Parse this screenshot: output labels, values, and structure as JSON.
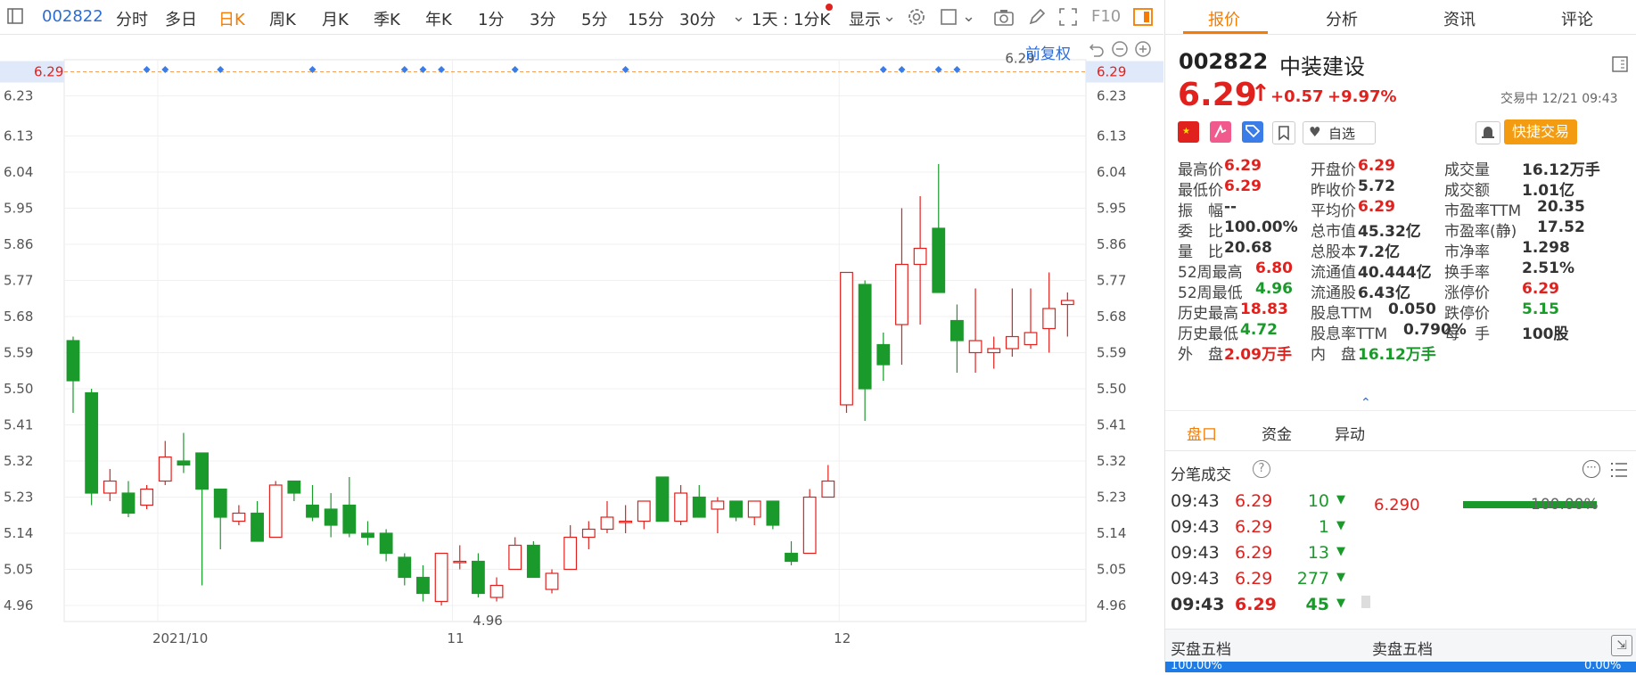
{
  "toolbar": {
    "code": "002822",
    "items": [
      "分时",
      "多日",
      "日K",
      "周K",
      "月K",
      "季K",
      "年K",
      "1分",
      "3分",
      "5分",
      "15分",
      "30分"
    ],
    "active": "日K",
    "range": "1天 : 1分K",
    "display": "显示",
    "f10": "F10"
  },
  "chart": {
    "fq_label": "前复权",
    "current_price": "6.29",
    "current_price_tag": "6.29",
    "high_label": "6.29",
    "low_label": "4.96",
    "x_labels": [
      "2021/10",
      "11",
      "12"
    ],
    "y_ticks": [
      "6.23",
      "6.13",
      "6.04",
      "5.95",
      "5.86",
      "5.77",
      "5.68",
      "5.59",
      "5.50",
      "5.41",
      "5.32",
      "5.23",
      "5.14",
      "5.05",
      "4.96"
    ]
  },
  "chart_data": {
    "type": "candlestick",
    "ylim": [
      4.92,
      6.32
    ],
    "y_ticks": [
      6.23,
      6.13,
      6.04,
      5.95,
      5.86,
      5.77,
      5.68,
      5.59,
      5.5,
      5.41,
      5.32,
      5.23,
      5.14,
      5.05,
      4.96
    ],
    "x_labels": [
      "2021/10",
      "11",
      "12"
    ],
    "current_price": 6.29,
    "max_label": 6.29,
    "min_label": 4.96,
    "candles": [
      {
        "o": 5.62,
        "c": 5.52,
        "h": 5.63,
        "l": 5.44
      },
      {
        "o": 5.49,
        "c": 5.24,
        "h": 5.5,
        "l": 5.21
      },
      {
        "o": 5.24,
        "c": 5.27,
        "h": 5.3,
        "l": 5.22
      },
      {
        "o": 5.24,
        "c": 5.19,
        "h": 5.27,
        "l": 5.18
      },
      {
        "o": 5.21,
        "c": 5.25,
        "h": 5.26,
        "l": 5.2
      },
      {
        "o": 5.27,
        "c": 5.33,
        "h": 5.37,
        "l": 5.26
      },
      {
        "o": 5.32,
        "c": 5.31,
        "h": 5.39,
        "l": 5.29
      },
      {
        "o": 5.34,
        "c": 5.25,
        "h": 5.34,
        "l": 5.01
      },
      {
        "o": 5.25,
        "c": 5.18,
        "h": 5.25,
        "l": 5.1
      },
      {
        "o": 5.17,
        "c": 5.19,
        "h": 5.21,
        "l": 5.16
      },
      {
        "o": 5.19,
        "c": 5.12,
        "h": 5.22,
        "l": 5.12
      },
      {
        "o": 5.13,
        "c": 5.26,
        "h": 5.27,
        "l": 5.13
      },
      {
        "o": 5.27,
        "c": 5.24,
        "h": 5.27,
        "l": 5.22
      },
      {
        "o": 5.21,
        "c": 5.18,
        "h": 5.26,
        "l": 5.17
      },
      {
        "o": 5.2,
        "c": 5.16,
        "h": 5.24,
        "l": 5.13
      },
      {
        "o": 5.21,
        "c": 5.14,
        "h": 5.28,
        "l": 5.13
      },
      {
        "o": 5.14,
        "c": 5.13,
        "h": 5.17,
        "l": 5.11
      },
      {
        "o": 5.14,
        "c": 5.09,
        "h": 5.15,
        "l": 5.07
      },
      {
        "o": 5.08,
        "c": 5.03,
        "h": 5.09,
        "l": 5.01
      },
      {
        "o": 5.03,
        "c": 4.99,
        "h": 5.06,
        "l": 4.97
      },
      {
        "o": 4.97,
        "c": 5.09,
        "h": 5.09,
        "l": 4.96
      },
      {
        "o": 5.07,
        "c": 5.07,
        "h": 5.11,
        "l": 5.05
      },
      {
        "o": 5.07,
        "c": 4.99,
        "h": 5.09,
        "l": 4.98
      },
      {
        "o": 4.98,
        "c": 5.01,
        "h": 5.03,
        "l": 4.97
      },
      {
        "o": 5.05,
        "c": 5.11,
        "h": 5.13,
        "l": 5.05
      },
      {
        "o": 5.11,
        "c": 5.03,
        "h": 5.12,
        "l": 5.03
      },
      {
        "o": 5.0,
        "c": 5.04,
        "h": 5.05,
        "l": 4.99
      },
      {
        "o": 5.05,
        "c": 5.13,
        "h": 5.16,
        "l": 5.05
      },
      {
        "o": 5.13,
        "c": 5.15,
        "h": 5.17,
        "l": 5.1
      },
      {
        "o": 5.15,
        "c": 5.18,
        "h": 5.22,
        "l": 5.14
      },
      {
        "o": 5.17,
        "c": 5.17,
        "h": 5.21,
        "l": 5.14
      },
      {
        "o": 5.17,
        "c": 5.22,
        "h": 5.22,
        "l": 5.15
      },
      {
        "o": 5.28,
        "c": 5.17,
        "h": 5.28,
        "l": 5.17
      },
      {
        "o": 5.17,
        "c": 5.24,
        "h": 5.26,
        "l": 5.16
      },
      {
        "o": 5.23,
        "c": 5.18,
        "h": 5.26,
        "l": 5.18
      },
      {
        "o": 5.2,
        "c": 5.22,
        "h": 5.23,
        "l": 5.14
      },
      {
        "o": 5.22,
        "c": 5.18,
        "h": 5.21,
        "l": 5.17
      },
      {
        "o": 5.18,
        "c": 5.22,
        "h": 5.22,
        "l": 5.16
      },
      {
        "o": 5.22,
        "c": 5.16,
        "h": 5.22,
        "l": 5.15
      },
      {
        "o": 5.09,
        "c": 5.07,
        "h": 5.12,
        "l": 5.06
      },
      {
        "o": 5.09,
        "c": 5.23,
        "h": 5.25,
        "l": 5.09
      },
      {
        "o": 5.23,
        "c": 5.27,
        "h": 5.31,
        "l": 5.23
      },
      {
        "o": 5.46,
        "c": 5.79,
        "h": 5.79,
        "l": 5.44
      },
      {
        "o": 5.76,
        "c": 5.5,
        "h": 5.77,
        "l": 5.42
      },
      {
        "o": 5.61,
        "c": 5.56,
        "h": 5.64,
        "l": 5.52
      },
      {
        "o": 5.66,
        "c": 5.81,
        "h": 5.95,
        "l": 5.56
      },
      {
        "o": 5.81,
        "c": 5.85,
        "h": 5.98,
        "l": 5.66
      },
      {
        "o": 5.9,
        "c": 5.74,
        "h": 6.06,
        "l": 5.74
      },
      {
        "o": 5.67,
        "c": 5.62,
        "h": 5.71,
        "l": 5.54
      },
      {
        "o": 5.59,
        "c": 5.62,
        "h": 5.75,
        "l": 5.54
      },
      {
        "o": 5.59,
        "c": 5.6,
        "h": 5.63,
        "l": 5.55
      },
      {
        "o": 5.6,
        "c": 5.63,
        "h": 5.75,
        "l": 5.58
      },
      {
        "o": 5.61,
        "c": 5.64,
        "h": 5.75,
        "l": 5.6
      },
      {
        "o": 5.65,
        "c": 5.7,
        "h": 5.79,
        "l": 5.59
      },
      {
        "o": 5.71,
        "c": 5.72,
        "h": 5.74,
        "l": 5.63
      }
    ]
  },
  "panel": {
    "tabs": [
      "报价",
      "分析",
      "资讯",
      "评论"
    ],
    "active_tab": "报价",
    "code": "002822",
    "name": "中装建设",
    "price": "6.29",
    "change": "+0.57",
    "change_pct": "+9.97%",
    "status": "交易中 12/21 09:43",
    "watch_label": "自选",
    "quick_trade": "快捷交易",
    "quote_cols": [
      [
        {
          "label": "最高价",
          "value": "6.29",
          "color": "red"
        },
        {
          "label": "最低价",
          "value": "6.29",
          "color": "red"
        },
        {
          "label": "振　幅",
          "value": "--",
          "color": "blk"
        },
        {
          "label": "委　比",
          "value": "100.00%",
          "color": "blk"
        },
        {
          "label": "量　比",
          "value": "20.68",
          "color": "blk"
        },
        {
          "label": "52周最高",
          "value": "6.80",
          "color": "red"
        },
        {
          "label": "52周最低",
          "value": "4.96",
          "color": "green"
        },
        {
          "label": "历史最高",
          "value": "18.83",
          "color": "red"
        },
        {
          "label": "历史最低",
          "value": "4.72",
          "color": "green"
        },
        {
          "label": "外　盘",
          "value": "2.09万手",
          "color": "red"
        }
      ],
      [
        {
          "label": "开盘价",
          "value": "6.29",
          "color": "red"
        },
        {
          "label": "昨收价",
          "value": "5.72",
          "color": "blk"
        },
        {
          "label": "平均价",
          "value": "6.29",
          "color": "red"
        },
        {
          "label": "总市值",
          "value": "45.32亿",
          "color": "blk"
        },
        {
          "label": "总股本",
          "value": "7.2亿",
          "color": "blk"
        },
        {
          "label": "流通值",
          "value": "40.444亿",
          "color": "blk"
        },
        {
          "label": "流通股",
          "value": "6.43亿",
          "color": "blk"
        },
        {
          "label": "股息TTM",
          "value": "0.050",
          "color": "blk"
        },
        {
          "label": "股息率TTM",
          "value": "0.790%",
          "color": "blk"
        },
        {
          "label": "内　盘",
          "value": "16.12万手",
          "color": "green"
        }
      ],
      [
        {
          "label": "成交量",
          "value": "16.12万手",
          "color": "blk"
        },
        {
          "label": "成交额",
          "value": "1.01亿",
          "color": "blk"
        },
        {
          "label": "市盈率TTM",
          "value": "20.35",
          "color": "blk"
        },
        {
          "label": "市盈率(静)",
          "value": "17.52",
          "color": "blk"
        },
        {
          "label": "市净率",
          "value": "1.298",
          "color": "blk"
        },
        {
          "label": "换手率",
          "value": "2.51%",
          "color": "blk"
        },
        {
          "label": "涨停价",
          "value": "6.29",
          "color": "red"
        },
        {
          "label": "跌停价",
          "value": "5.15",
          "color": "green"
        },
        {
          "label": "每　手",
          "value": "100股",
          "color": "blk"
        }
      ]
    ],
    "sub_tabs": [
      "盘口",
      "资金",
      "异动"
    ],
    "active_sub_tab": "盘口",
    "trades_title": "分笔成交",
    "trades": [
      {
        "time": "09:43",
        "price": "6.29",
        "vol": "10"
      },
      {
        "time": "09:43",
        "price": "6.29",
        "vol": "1"
      },
      {
        "time": "09:43",
        "price": "6.29",
        "vol": "13"
      },
      {
        "time": "09:43",
        "price": "6.29",
        "vol": "277"
      },
      {
        "time": "09:43",
        "price": "6.29",
        "vol": "45"
      }
    ],
    "dist_price": "6.290",
    "dist_pct": "100.00%",
    "dist_fill": 1.0,
    "buy5": "买盘五档",
    "sell5": "卖盘五档",
    "bottom_pct": "100.00%",
    "corner_pct": "0.00%"
  }
}
